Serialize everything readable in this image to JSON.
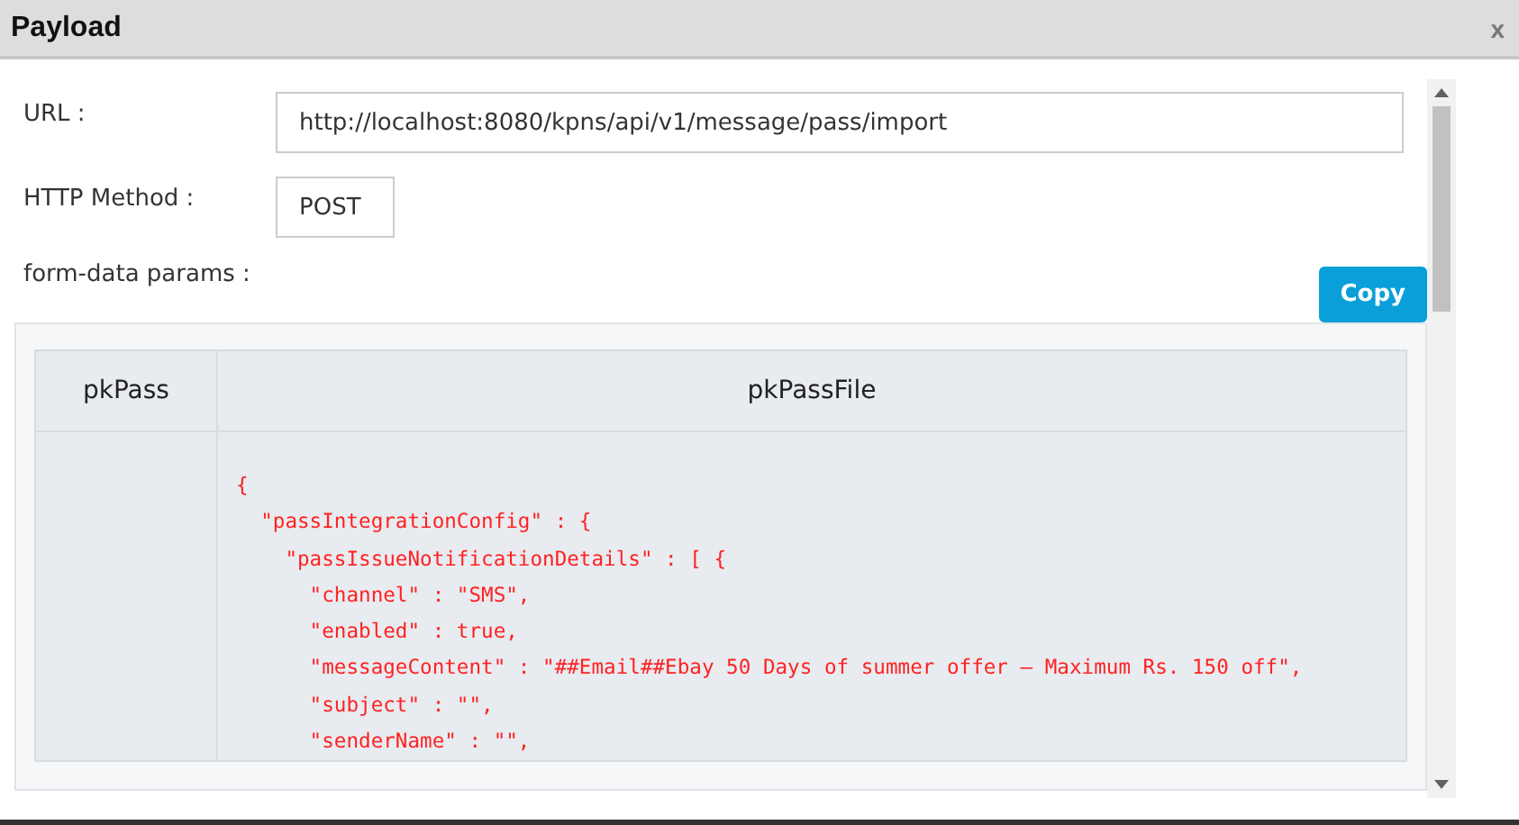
{
  "window": {
    "title": "Payload",
    "close": "x"
  },
  "fields": [
    {
      "label": "URL :",
      "value": "http://localhost:8080/kpns/api/v1/message/pass/import",
      "kind": "wide"
    },
    {
      "label": "HTTP Method :",
      "value": "POST",
      "kind": "narrow"
    }
  ],
  "params_label": "form-data params :",
  "copy_button": "Copy",
  "table": {
    "columns": [
      "pkPass",
      "pkPassFile"
    ],
    "rows": [
      {
        "pkPass": "",
        "code": [
          "{",
          "  \"passIntegrationConfig\" : {",
          "    \"passIssueNotificationDetails\" : [ {",
          "      \"channel\" : \"SMS\",",
          "      \"enabled\" : true,",
          "      \"messageContent\" : \"##Email##Ebay 50 Days of summer offer – Maximum Rs. 150 off\",",
          "      \"subject\" : \"\",",
          "      \"senderName\" : \"\","
        ]
      }
    ]
  }
}
